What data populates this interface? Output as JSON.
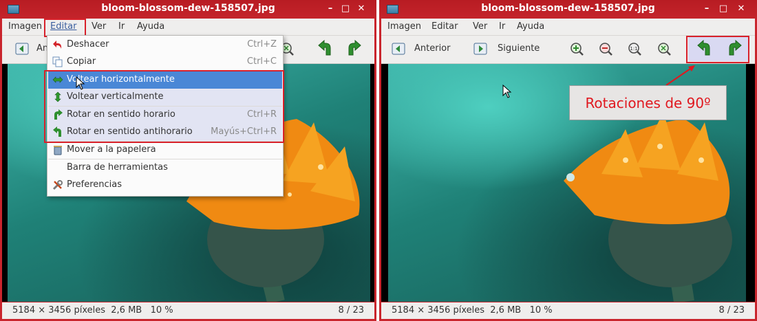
{
  "window_title": "bloom-blossom-dew-158507.jpg",
  "menu": [
    "Imagen",
    "Editar",
    "Ver",
    "Ir",
    "Ayuda"
  ],
  "toolbar": {
    "prev_label": "Anterior",
    "next_label": "Siguiente"
  },
  "dropdown": [
    {
      "label": "Deshacer",
      "accel": "Ctrl+Z",
      "icon": "undo-icon"
    },
    {
      "label": "Copiar",
      "accel": "Ctrl+C",
      "icon": "copy-icon"
    },
    {
      "label": "Voltear horizontalmente",
      "accel": "",
      "icon": "flip-horizontal-icon"
    },
    {
      "label": "Voltear verticalmente",
      "accel": "",
      "icon": "flip-vertical-icon"
    },
    {
      "label": "Rotar en sentido horario",
      "accel": "Ctrl+R",
      "icon": "rotate-clockwise-icon"
    },
    {
      "label": "Rotar en sentido antihorario",
      "accel": "Mayús+Ctrl+R",
      "icon": "rotate-counterclockwise-icon"
    },
    {
      "label": "Mover a la papelera",
      "accel": "",
      "icon": "trash-icon"
    },
    {
      "label": "Barra de herramientas",
      "accel": "",
      "icon": ""
    },
    {
      "label": "Preferencias",
      "accel": "",
      "icon": "preferences-icon"
    }
  ],
  "status": {
    "info": "5184 × 3456 píxeles  2,6 MB   10 %",
    "page": "8 / 23"
  },
  "callout": "Rotaciones de 90º",
  "colors": {
    "titlebar": "#c4242b",
    "highlight": "#4a87d6",
    "annotation": "#e0181f"
  }
}
